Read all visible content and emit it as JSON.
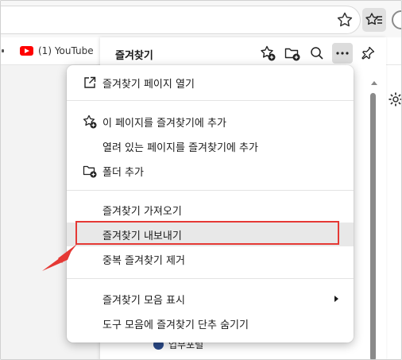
{
  "bookmarks_bar": {
    "youtube_label": "(1) YouTube"
  },
  "favorites_panel": {
    "title": "즐겨찾기",
    "partial_item_label": "업무포털"
  },
  "menu": {
    "items": [
      {
        "label": "즐겨찾기 페이지 열기",
        "icon": "open-external-icon"
      },
      {
        "label": "이 페이지를 즐겨찾기에 추가",
        "icon": "star-add-icon"
      },
      {
        "label": "열려 있는 페이지를 즐겨찾기에 추가",
        "icon": ""
      },
      {
        "label": "폴더 추가",
        "icon": "folder-add-icon"
      },
      {
        "label": "즐겨찾기 가져오기",
        "icon": ""
      },
      {
        "label": "즐겨찾기 내보내기",
        "icon": "",
        "highlighted": true
      },
      {
        "label": "중복 즐겨찾기 제거",
        "icon": ""
      },
      {
        "label": "즐겨찾기 모음 표시",
        "icon": "",
        "submenu": true
      },
      {
        "label": "도구 모음에 즐겨찾기 단추 숨기기",
        "icon": ""
      }
    ]
  },
  "colors": {
    "highlight_box": "#e53935",
    "annotation_arrow": "#e53935",
    "menu_highlight": "#e8e8e8",
    "youtube_red": "#ff0000"
  }
}
